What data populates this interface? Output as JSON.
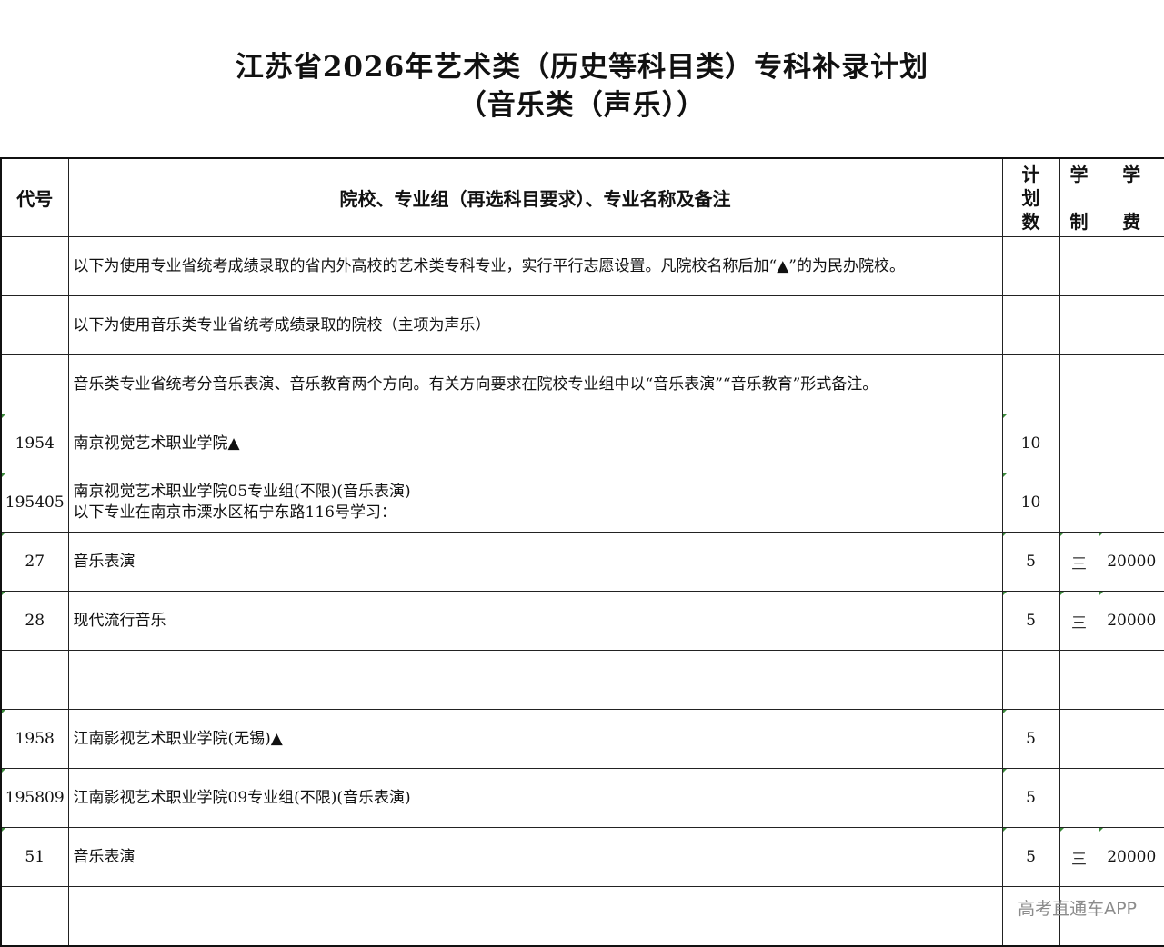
{
  "title": {
    "line1": "江苏省2026年艺术类（历史等科目类）专科补录计划",
    "line2": "（音乐类（声乐））"
  },
  "table": {
    "headers": {
      "code": "代号",
      "name": "院校、专业组（再选科目要求）、专业名称及备注",
      "plan": [
        "计",
        "划",
        "数"
      ],
      "years": [
        "学",
        "制"
      ],
      "fee": [
        "学",
        "费"
      ]
    },
    "rows": [
      {
        "code": "",
        "name": "以下为使用专业省统考成绩录取的省内外高校的艺术类专科专业，实行平行志愿设置。凡院校名称后加“▲”的为民办院校。",
        "plan": "",
        "years": "",
        "fee": ""
      },
      {
        "code": "",
        "name": "以下为使用音乐类专业省统考成绩录取的院校（主项为声乐）",
        "plan": "",
        "years": "",
        "fee": ""
      },
      {
        "code": "",
        "name": "音乐类专业省统考分音乐表演、音乐教育两个方向。有关方向要求在院校专业组中以“音乐表演”“音乐教育”形式备注。",
        "plan": "",
        "years": "",
        "fee": ""
      },
      {
        "code": "1954",
        "name": "南京视觉艺术职业学院▲",
        "plan": "10",
        "years": "",
        "fee": ""
      },
      {
        "code": "195405",
        "name": "南京视觉艺术职业学院05专业组(不限)(音乐表演)",
        "name2": "以下专业在南京市溧水区柘宁东路116号学习：",
        "plan": "10",
        "years": "",
        "fee": ""
      },
      {
        "code": "27",
        "name": "音乐表演",
        "plan": "5",
        "years": "三",
        "fee": "20000"
      },
      {
        "code": "28",
        "name": "现代流行音乐",
        "plan": "5",
        "years": "三",
        "fee": "20000"
      },
      {
        "code": "",
        "name": "",
        "plan": "",
        "years": "",
        "fee": ""
      },
      {
        "code": "1958",
        "name": "江南影视艺术职业学院(无锡)▲",
        "plan": "5",
        "years": "",
        "fee": ""
      },
      {
        "code": "195809",
        "name": "江南影视艺术职业学院09专业组(不限)(音乐表演)",
        "plan": "5",
        "years": "",
        "fee": ""
      },
      {
        "code": "51",
        "name": "音乐表演",
        "plan": "5",
        "years": "三",
        "fee": "20000"
      },
      {
        "code": "",
        "name": "",
        "plan": "",
        "years": "",
        "fee": ""
      }
    ]
  },
  "watermark": "高考直通车APP",
  "colors": {
    "text": "#111111",
    "border": "#222222",
    "corner_mark": "#3a8a3a",
    "watermark": "#8c8c8c"
  }
}
